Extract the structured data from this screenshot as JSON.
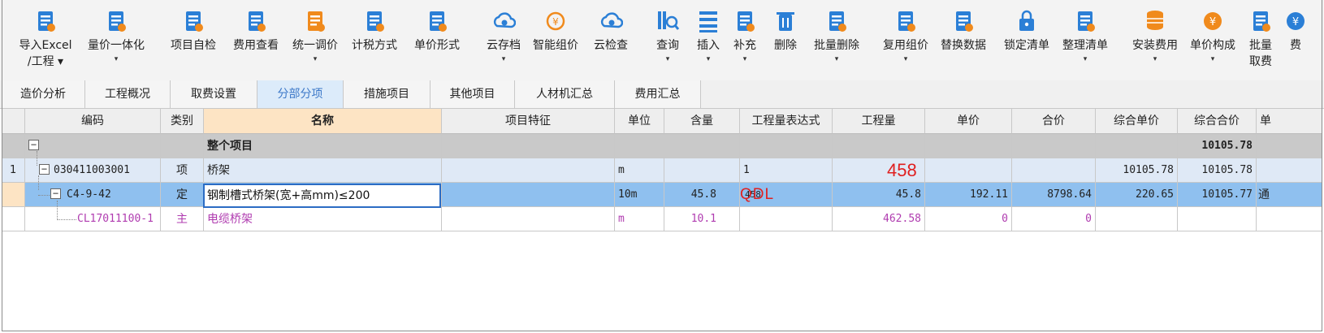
{
  "toolbar": {
    "buttons": [
      {
        "label": "导入Excel",
        "label2": "/工程 ▾",
        "icon": "import-excel-icon",
        "color": "#2b7fd6"
      },
      {
        "label": "量价一体化",
        "label2": "▾",
        "icon": "quantity-price-icon",
        "color": "#2b7fd6"
      },
      {
        "label": "项目自检",
        "icon": "project-check-icon",
        "color": "#2b7fd6"
      },
      {
        "label": "费用查看",
        "icon": "cost-view-icon",
        "color": "#2b7fd6"
      },
      {
        "label": "统一调价",
        "label2": "▾",
        "icon": "unified-price-icon",
        "color": "#f08a1c"
      },
      {
        "label": "计税方式",
        "icon": "tax-method-icon",
        "color": "#2b7fd6"
      },
      {
        "label": "单价形式",
        "icon": "unit-price-form-icon",
        "color": "#2b7fd6"
      },
      {
        "label": "云存档",
        "label2": "▾",
        "icon": "cloud-archive-icon",
        "color": "#2b7fd6"
      },
      {
        "label": "智能组价",
        "icon": "smart-pricing-icon",
        "color": "#f08a1c"
      },
      {
        "label": "云检查",
        "icon": "cloud-check-icon",
        "color": "#2b7fd6"
      },
      {
        "label": "查询",
        "label2": "▾",
        "icon": "query-icon",
        "color": "#2b7fd6"
      },
      {
        "label": "插入",
        "label2": "▾",
        "icon": "insert-icon",
        "color": "#2b7fd6"
      },
      {
        "label": "补充",
        "label2": "▾",
        "icon": "supplement-icon",
        "color": "#2b7fd6"
      },
      {
        "label": "删除",
        "icon": "delete-icon",
        "color": "#2b7fd6"
      },
      {
        "label": "批量删除",
        "label2": "▾",
        "icon": "batch-delete-icon",
        "color": "#2b7fd6"
      },
      {
        "label": "复用组价",
        "label2": "▾",
        "icon": "reuse-pricing-icon",
        "color": "#2b7fd6"
      },
      {
        "label": "替换数据",
        "icon": "replace-data-icon",
        "color": "#2b7fd6"
      },
      {
        "label": "锁定清单",
        "icon": "lock-list-icon",
        "color": "#2b7fd6"
      },
      {
        "label": "整理清单",
        "label2": "▾",
        "icon": "organize-list-icon",
        "color": "#2b7fd6"
      },
      {
        "label": "安装费用",
        "label2": "▾",
        "icon": "install-cost-icon",
        "color": "#f08a1c"
      },
      {
        "label": "单价构成",
        "label2": "▾",
        "icon": "unit-price-composition-icon",
        "color": "#f08a1c"
      },
      {
        "label": "批量",
        "label2": "取费",
        "icon": "batch-fee-icon",
        "color": "#2b7fd6"
      },
      {
        "label": "费",
        "icon": "fee-icon",
        "color": "#2b7fd6"
      }
    ]
  },
  "tabs": [
    {
      "label": "造价分析",
      "active": false
    },
    {
      "label": "工程概况",
      "active": false
    },
    {
      "label": "取费设置",
      "active": false
    },
    {
      "label": "分部分项",
      "active": true
    },
    {
      "label": "措施项目",
      "active": false
    },
    {
      "label": "其他项目",
      "active": false
    },
    {
      "label": "人材机汇总",
      "active": false
    },
    {
      "label": "费用汇总",
      "active": false
    }
  ],
  "grid": {
    "headers": [
      "",
      "编码",
      "类别",
      "名称",
      "项目特征",
      "单位",
      "含量",
      "工程量表达式",
      "工程量",
      "单价",
      "合价",
      "综合单价",
      "综合合价",
      "单"
    ],
    "rows": [
      {
        "index": "",
        "code": "",
        "type": "",
        "name": "整个项目",
        "feature": "",
        "unit": "",
        "content": "",
        "expr": "",
        "qty": "",
        "price": "",
        "total": "",
        "unit_comp": "",
        "total_comp": "10105.78",
        "extra": ""
      },
      {
        "index": "1",
        "code": "030411003001",
        "type": "项",
        "name": "桥架",
        "feature": "",
        "unit": "m",
        "content": "",
        "expr": "1",
        "qty": "",
        "price": "",
        "total": "",
        "unit_comp": "10105.78",
        "total_comp": "10105.78",
        "extra": ""
      },
      {
        "index": "",
        "code": "C4-9-42",
        "type": "定",
        "name": "钢制槽式桥架(宽+高mm)≤200",
        "feature": "",
        "unit": "10m",
        "content": "45.8",
        "expr": "458",
        "qty": "45.8",
        "price": "192.11",
        "total": "8798.64",
        "unit_comp": "220.65",
        "total_comp": "10105.77",
        "extra": "通"
      },
      {
        "index": "",
        "code": "CL17011100-1",
        "type": "主",
        "name": "电缆桥架",
        "feature": "",
        "unit": "m",
        "content": "10.1",
        "expr": "",
        "qty": "462.58",
        "price": "0",
        "total": "0",
        "unit_comp": "",
        "total_comp": "",
        "extra": ""
      }
    ],
    "overlay_qty": "458",
    "overlay_expr": "QDL",
    "expand_symbol": "−"
  },
  "colors": {
    "selected_row": "#8fc0ef",
    "parent_row": "#dfe9f6",
    "summary_row": "#c9c9c9",
    "material_text": "#b03cb0",
    "overlay_red": "#e02020",
    "active_tab_text": "#3c78c8"
  }
}
